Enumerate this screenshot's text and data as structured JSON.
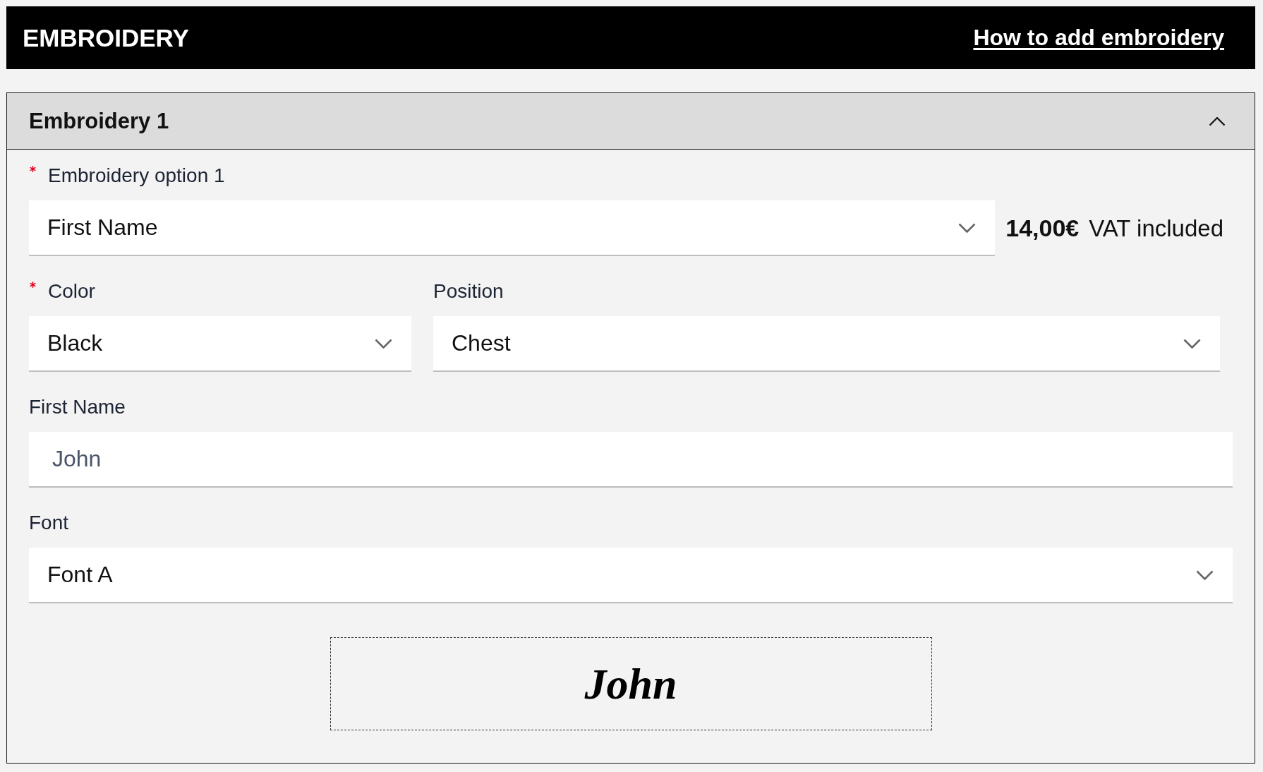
{
  "header": {
    "title": "EMBROIDERY",
    "help_link": "How to add embroidery"
  },
  "panel": {
    "title": "Embroidery 1",
    "expanded": true,
    "rows": [
      {
        "fields": [
          {
            "kind": "select",
            "label": "Embroidery option 1",
            "required": true,
            "value": "First Name",
            "price": "14,00€",
            "price_note": "VAT included"
          }
        ]
      },
      {
        "fields": [
          {
            "kind": "select",
            "label": "Color",
            "required": true,
            "value": "Black"
          },
          {
            "kind": "select",
            "label": "Position",
            "required": false,
            "value": "Chest"
          }
        ]
      },
      {
        "fields": [
          {
            "kind": "text",
            "label": "First Name",
            "required": false,
            "placeholder": "John"
          }
        ]
      },
      {
        "fields": [
          {
            "kind": "select",
            "label": "Font",
            "required": false,
            "value": "Font A"
          }
        ]
      }
    ],
    "preview": {
      "text": "John"
    }
  }
}
